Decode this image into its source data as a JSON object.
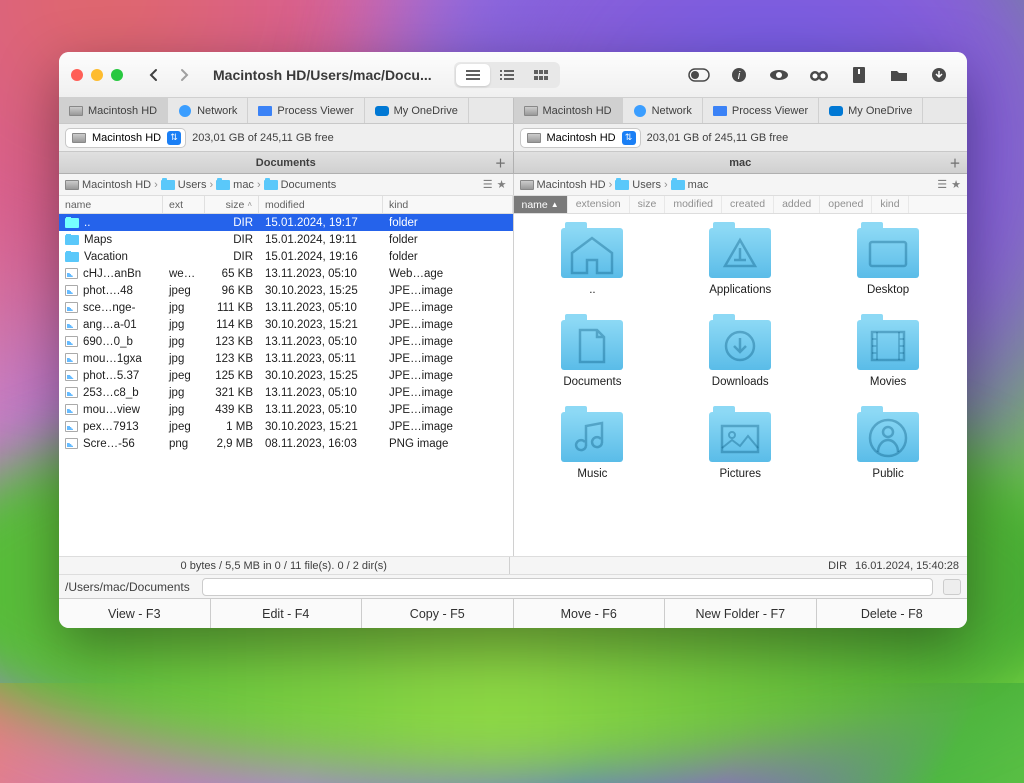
{
  "title_path": "Macintosh HD/Users/mac/Docu...",
  "tabs": {
    "left": [
      {
        "label": "Macintosh HD",
        "icon": "hd"
      },
      {
        "label": "Network",
        "icon": "globe"
      },
      {
        "label": "Process Viewer",
        "icon": "proc"
      },
      {
        "label": "My OneDrive",
        "icon": "cloud"
      }
    ],
    "right": [
      {
        "label": "Macintosh HD",
        "icon": "hd"
      },
      {
        "label": "Network",
        "icon": "globe"
      },
      {
        "label": "Process Viewer",
        "icon": "proc"
      },
      {
        "label": "My OneDrive",
        "icon": "cloud"
      }
    ]
  },
  "drive": {
    "left": {
      "name": "Macintosh HD",
      "info": "203,01 GB of 245,11 GB free"
    },
    "right": {
      "name": "Macintosh HD",
      "info": "203,01 GB of 245,11 GB free"
    }
  },
  "pane_titles": {
    "left": "Documents",
    "right": "mac"
  },
  "breadcrumbs": {
    "left": [
      "Macintosh HD",
      "Users",
      "mac",
      "Documents"
    ],
    "right": [
      "Macintosh HD",
      "Users",
      "mac"
    ]
  },
  "list_headers": [
    "name",
    "ext",
    "size",
    "modified",
    "kind"
  ],
  "icon_headers": [
    "name",
    "extension",
    "size",
    "modified",
    "created",
    "added",
    "opened",
    "kind"
  ],
  "files": [
    {
      "name": "..",
      "ext": "",
      "size": "DIR",
      "modified": "15.01.2024, 19:17",
      "kind": "folder",
      "icon": "folder",
      "selected": true
    },
    {
      "name": "Maps",
      "ext": "",
      "size": "DIR",
      "modified": "15.01.2024, 19:11",
      "kind": "folder",
      "icon": "folder"
    },
    {
      "name": "Vacation",
      "ext": "",
      "size": "DIR",
      "modified": "15.01.2024, 19:16",
      "kind": "folder",
      "icon": "folder"
    },
    {
      "name": "cHJ…anBn",
      "ext": "we…",
      "size": "65 KB",
      "modified": "13.11.2023, 05:10",
      "kind": "Web…age",
      "icon": "img"
    },
    {
      "name": "phot….48",
      "ext": "jpeg",
      "size": "96 KB",
      "modified": "30.10.2023, 15:25",
      "kind": "JPE…image",
      "icon": "img"
    },
    {
      "name": "sce…nge-",
      "ext": "jpg",
      "size": "111 KB",
      "modified": "13.11.2023, 05:10",
      "kind": "JPE…image",
      "icon": "img"
    },
    {
      "name": "ang…a-01",
      "ext": "jpg",
      "size": "114 KB",
      "modified": "30.10.2023, 15:21",
      "kind": "JPE…image",
      "icon": "img"
    },
    {
      "name": "690…0_b",
      "ext": "jpg",
      "size": "123 KB",
      "modified": "13.11.2023, 05:10",
      "kind": "JPE…image",
      "icon": "img"
    },
    {
      "name": "mou…1gxa",
      "ext": "jpg",
      "size": "123 KB",
      "modified": "13.11.2023, 05:11",
      "kind": "JPE…image",
      "icon": "img"
    },
    {
      "name": "phot…5.37",
      "ext": "jpeg",
      "size": "125 KB",
      "modified": "30.10.2023, 15:25",
      "kind": "JPE…image",
      "icon": "img"
    },
    {
      "name": "253…c8_b",
      "ext": "jpg",
      "size": "321 KB",
      "modified": "13.11.2023, 05:10",
      "kind": "JPE…image",
      "icon": "img"
    },
    {
      "name": "mou…view",
      "ext": "jpg",
      "size": "439 KB",
      "modified": "13.11.2023, 05:10",
      "kind": "JPE…image",
      "icon": "img"
    },
    {
      "name": "pex…7913",
      "ext": "jpeg",
      "size": "1 MB",
      "modified": "30.10.2023, 15:21",
      "kind": "JPE…image",
      "icon": "img"
    },
    {
      "name": "Scre…-56",
      "ext": "png",
      "size": "2,9 MB",
      "modified": "08.11.2023, 16:03",
      "kind": "PNG image",
      "icon": "img"
    }
  ],
  "icons": [
    {
      "label": "..",
      "glyph": "home"
    },
    {
      "label": "Applications",
      "glyph": "apps"
    },
    {
      "label": "Desktop",
      "glyph": "desktop"
    },
    {
      "label": "Documents",
      "glyph": "doc"
    },
    {
      "label": "Downloads",
      "glyph": "down"
    },
    {
      "label": "Movies",
      "glyph": "movie"
    },
    {
      "label": "Music",
      "glyph": "music"
    },
    {
      "label": "Pictures",
      "glyph": "pic"
    },
    {
      "label": "Public",
      "glyph": "public"
    }
  ],
  "status": {
    "left": "0 bytes / 5,5 MB in 0 / 11 file(s). 0 / 2 dir(s)",
    "right_kind": "DIR",
    "right_date": "16.01.2024, 15:40:28"
  },
  "path_display": "/Users/mac/Documents",
  "actions": [
    "View - F3",
    "Edit - F4",
    "Copy - F5",
    "Move - F6",
    "New Folder - F7",
    "Delete - F8"
  ]
}
